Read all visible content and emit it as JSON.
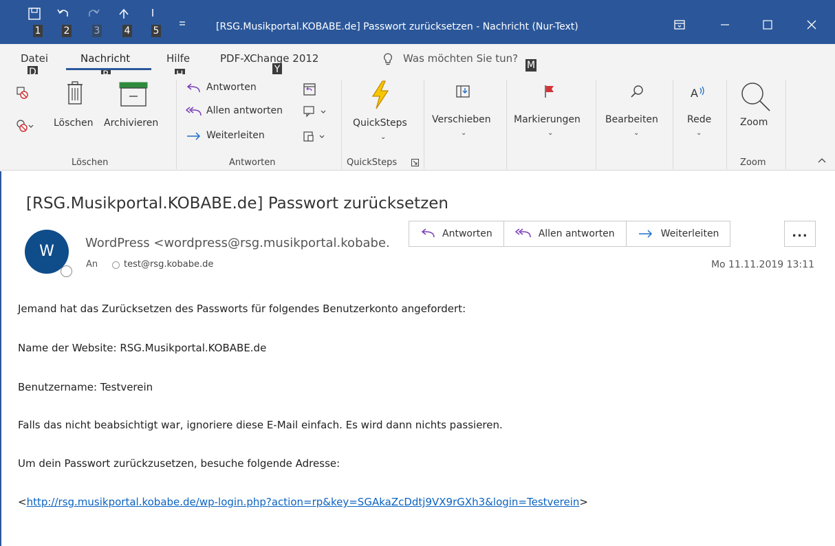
{
  "titlebar": {
    "title": "[RSG.Musikportal.KOBABE.de] Passwort zurücksetzen  -  Nachricht (Nur-Text)",
    "qat": [
      {
        "icon": "save-icon",
        "keytip": "1"
      },
      {
        "icon": "undo-icon",
        "keytip": "2"
      },
      {
        "icon": "redo-icon",
        "keytip": "3"
      },
      {
        "icon": "up-arrow-icon",
        "keytip": "4"
      },
      {
        "icon": "down-arrow-icon",
        "keytip": "5"
      }
    ],
    "customize_icon": "customize-qat-icon",
    "window_buttons": [
      "ribbon-display-icon",
      "minimize-icon",
      "maximize-icon",
      "close-icon"
    ]
  },
  "tabs": [
    {
      "label": "Datei",
      "keytip": "D"
    },
    {
      "label": "Nachricht",
      "keytip": "R",
      "selected": true
    },
    {
      "label": "Hilfe",
      "keytip": "H"
    },
    {
      "label": "PDF-XChange 2012",
      "keytip": "Y"
    }
  ],
  "tellme": {
    "text": "Was möchten Sie tun?",
    "keytip": "M",
    "icon": "lightbulb-icon"
  },
  "ribbon": {
    "loeschen": {
      "delete_label": "Löschen",
      "archive_label": "Archivieren",
      "group_label": "Löschen"
    },
    "antworten": {
      "reply": "Antworten",
      "reply_all": "Allen antworten",
      "forward": "Weiterleiten",
      "group_label": "Antworten"
    },
    "quicksteps": {
      "label": "QuickSteps",
      "group_label": "QuickSteps"
    },
    "verschieben": {
      "label": "Verschieben"
    },
    "markierungen": {
      "label": "Markierungen"
    },
    "bearbeiten": {
      "label": "Bearbeiten"
    },
    "rede": {
      "label": "Rede"
    },
    "zoom": {
      "label": "Zoom",
      "group_label": "Zoom"
    }
  },
  "message": {
    "subject": "[RSG.Musikportal.KOBABE.de] Passwort zurücksetzen",
    "avatar_initial": "W",
    "sender": "WordPress <wordpress@rsg.musikportal.kobabe.de>",
    "to_label": "An",
    "to": "test@rsg.kobabe.de",
    "date": "Mo 11.11.2019 13:11",
    "actions": {
      "reply": "Antworten",
      "reply_all": "Allen antworten",
      "forward": "Weiterleiten",
      "more": "..."
    },
    "body": [
      "Jemand hat das Zurücksetzen des Passworts für folgendes Benutzerkonto angefordert:",
      "Name der Website: RSG.Musikportal.KOBABE.de",
      "Benutzername: Testverein",
      "Falls das nicht beabsichtigt war, ignoriere diese E-Mail einfach. Es wird dann nichts passieren.",
      "Um dein Passwort zurückzusetzen, besuche folgende Adresse:"
    ],
    "link_open": "<",
    "link": "http://rsg.musikportal.kobabe.de/wp-login.php?action=rp&key=SGAkaZcDdtj9VX9rGXh3&login=Testverein",
    "link_close": ">"
  },
  "colors": {
    "accent": "#2b579a",
    "flag": "#d13438",
    "quicksteps": "#f0b400",
    "link": "#0b63c1",
    "avatar": "#0f4c8a"
  }
}
